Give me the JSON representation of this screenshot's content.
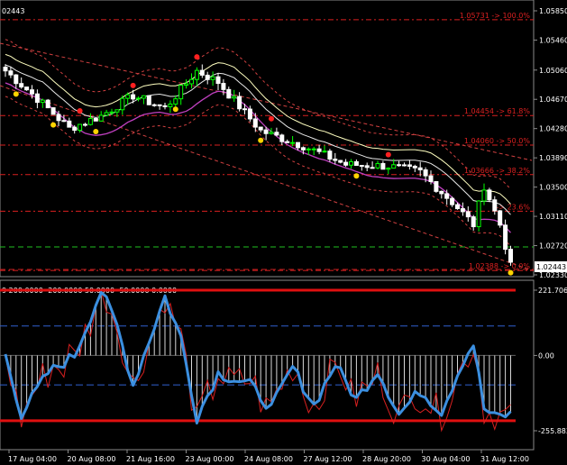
{
  "window": {
    "symbol_fragment": "02443",
    "indicator_params": "9 200.0000 -200.0000 50.0000 -50.0000 0.0000"
  },
  "price_axis": {
    "labels": [
      "1.05850",
      "1.05460",
      "1.05060",
      "1.04670",
      "1.04280",
      "1.03890",
      "1.03500",
      "1.03110",
      "1.02720",
      "1.02330"
    ],
    "current_price": "1.02443"
  },
  "fib_levels": [
    {
      "label": "1.05731 -> 100.0%",
      "price": 1.05731
    },
    {
      "label": "1.04454 -> 61.8%",
      "price": 1.04454
    },
    {
      "label": "1.04060 -> 50.0%",
      "price": 1.0406
    },
    {
      "label": "1.03666 -> 38.2%",
      "price": 1.03666
    },
    {
      "label": "-> 23.6%",
      "price": 1.03178
    },
    {
      "label": "1.02388 -> 0.0%",
      "price": 1.02388
    }
  ],
  "indicator_axis": {
    "labels": [
      "221.706",
      "0.00",
      "-255.883"
    ]
  },
  "time_axis": {
    "labels": [
      "17 Aug 04:00",
      "20 Aug 08:00",
      "21 Aug 16:00",
      "23 Aug 00:00",
      "24 Aug 08:00",
      "27 Aug 12:00",
      "28 Aug 20:00",
      "30 Aug 04:00",
      "31 Aug 12:00"
    ]
  },
  "colors": {
    "background": "#000000",
    "fib_line": "#d92020",
    "bull_candle": "#00ff00",
    "bear_candle": "#ffffff",
    "upper_band": "#ffffc0",
    "lower_band": "#c040c0",
    "channel": "#d04040",
    "signal_up": "#ff2020",
    "signal_down": "#ffd400",
    "cci_line": "#3b8fe0",
    "cci_fast": "#d82020",
    "level_line": "#3060d0"
  }
}
